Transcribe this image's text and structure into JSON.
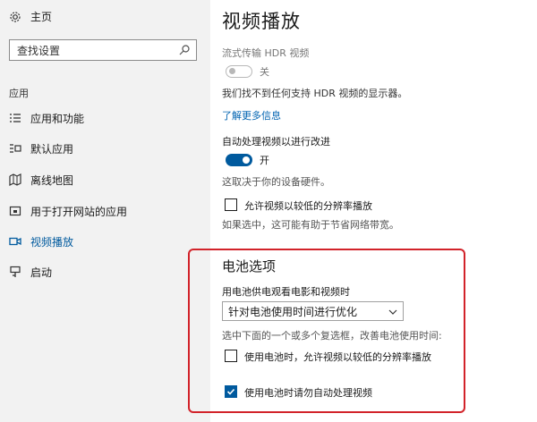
{
  "sidebar": {
    "home_label": "主页",
    "search_placeholder": "查找设置",
    "section_label": "应用",
    "items": [
      {
        "label": "应用和功能",
        "icon": "list-icon"
      },
      {
        "label": "默认应用",
        "icon": "default-apps-icon"
      },
      {
        "label": "离线地图",
        "icon": "map-icon"
      },
      {
        "label": "用于打开网站的应用",
        "icon": "open-website-icon"
      },
      {
        "label": "视频播放",
        "icon": "video-icon",
        "active": true
      },
      {
        "label": "启动",
        "icon": "startup-icon"
      }
    ]
  },
  "main": {
    "title": "视频播放",
    "hdr": {
      "label": "流式传输 HDR 视频",
      "toggle_state_label": "关",
      "toggle_on": false,
      "note": "我们找不到任何支持 HDR 视频的显示器。"
    },
    "learn_more": "了解更多信息",
    "auto_process": {
      "label": "自动处理视频以进行改进",
      "toggle_state_label": "开",
      "toggle_on": true,
      "note": "这取决于你的设备硬件。"
    },
    "low_res": {
      "label": "允许视频以较低的分辨率播放",
      "checked": false,
      "note": "如果选中，这可能有助于节省网络带宽。"
    },
    "battery": {
      "heading": "电池选项",
      "watch_label": "用电池供电观看电影和视频时",
      "dropdown_value": "针对电池使用时间进行优化",
      "hint": "选中下面的一个或多个复选框，改善电池使用时间:",
      "options": [
        {
          "label": "使用电池时，允许视频以较低的分辨率播放",
          "checked": false
        },
        {
          "label": "使用电池时请勿自动处理视频",
          "checked": true
        }
      ]
    }
  },
  "colors": {
    "accent": "#005a9e",
    "highlight_frame": "#d2232a",
    "sidebar_bg": "#f2f2f2"
  }
}
